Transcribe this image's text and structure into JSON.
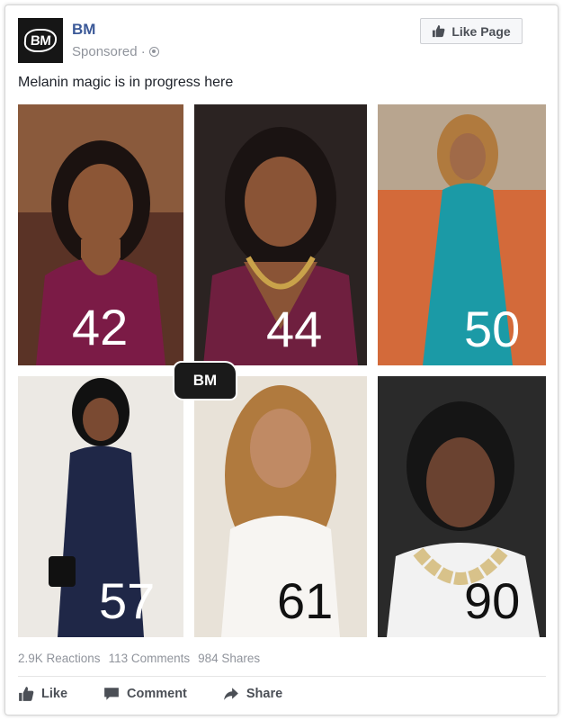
{
  "post": {
    "page_name": "BM",
    "logo_text": "BM",
    "sponsored_label": "Sponsored ·",
    "like_page_label": "Like Page",
    "text": "Melanin magic is in progress here"
  },
  "photo": {
    "overlay_logo": "BM",
    "tiles": [
      {
        "age": "42",
        "age_color": "#ffffff",
        "bg": "#7b1b46"
      },
      {
        "age": "44",
        "age_color": "#ffffff",
        "bg": "#6f1f3f"
      },
      {
        "age": "50",
        "age_color": "#ffffff",
        "bg": "#1b9aa6"
      },
      {
        "age": "57",
        "age_color": "#ffffff",
        "bg": "#1f2747"
      },
      {
        "age": "61",
        "age_color": "#111111",
        "bg": "#e8e2d8"
      },
      {
        "age": "90",
        "age_color": "#111111",
        "bg": "#f2f2f2"
      }
    ]
  },
  "stats": {
    "reactions": "2.9K Reactions",
    "comments": "113 Comments",
    "shares": "984 Shares"
  },
  "actions": {
    "like": "Like",
    "comment": "Comment",
    "share": "Share"
  },
  "colors": {
    "brand_blue": "#3b5998",
    "meta_gray": "#90949c",
    "action_gray": "#4b4f56"
  }
}
